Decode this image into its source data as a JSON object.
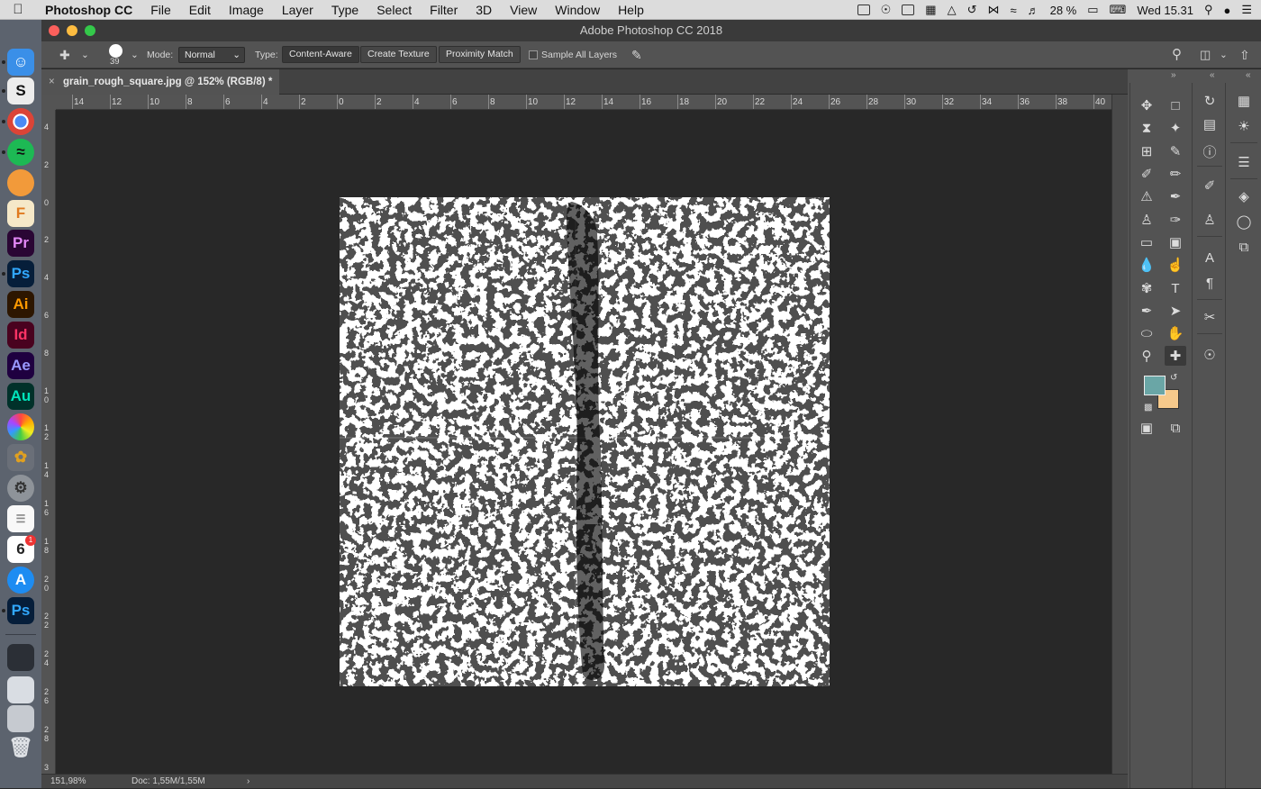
{
  "menubar": {
    "app_name": "Photoshop CC",
    "items": [
      "File",
      "Edit",
      "Image",
      "Layer",
      "Type",
      "Select",
      "Filter",
      "3D",
      "View",
      "Window",
      "Help"
    ],
    "battery": "28 %",
    "clock": "Wed 15.31"
  },
  "dock": {
    "apps": [
      {
        "name": "finder",
        "label": ""
      },
      {
        "name": "stack",
        "label": "S"
      },
      {
        "name": "chrome",
        "label": ""
      },
      {
        "name": "spotify",
        "label": ""
      },
      {
        "name": "other",
        "label": ""
      },
      {
        "name": "fusion",
        "label": "F"
      },
      {
        "name": "premiere",
        "label": "Pr"
      },
      {
        "name": "photoshop",
        "label": "Ps"
      },
      {
        "name": "illustrator",
        "label": "Ai"
      },
      {
        "name": "indesign",
        "label": "Id"
      },
      {
        "name": "aftereffects",
        "label": "Ae"
      },
      {
        "name": "audition",
        "label": "Au"
      },
      {
        "name": "photos",
        "label": ""
      },
      {
        "name": "fruit",
        "label": ""
      },
      {
        "name": "prefs",
        "label": ""
      },
      {
        "name": "reminders",
        "label": ""
      },
      {
        "name": "calendar",
        "label": "6"
      },
      {
        "name": "appstore",
        "label": ""
      },
      {
        "name": "photoshop2",
        "label": "Ps"
      }
    ],
    "calendar_badge": "1"
  },
  "window": {
    "title": "Adobe Photoshop CC 2018"
  },
  "options": {
    "brush_size": "39",
    "mode_label": "Mode:",
    "mode_value": "Normal",
    "type_label": "Type:",
    "type_buttons": [
      "Content-Aware",
      "Create Texture",
      "Proximity Match"
    ],
    "sample_all_layers": "Sample All Layers"
  },
  "document": {
    "tab_title": "grain_rough_square.jpg @ 152% (RGB/8) *",
    "close": "×"
  },
  "rulers": {
    "horizontal": [
      "14",
      "12",
      "10",
      "8",
      "6",
      "4",
      "2",
      "0",
      "2",
      "4",
      "6",
      "8",
      "10",
      "12",
      "14",
      "16",
      "18",
      "20",
      "22",
      "24",
      "26",
      "28",
      "30",
      "32",
      "34",
      "36",
      "38",
      "40"
    ],
    "vertical": [
      "4",
      "2",
      "0",
      "2",
      "4",
      "6",
      "8",
      "1\n0",
      "1\n2",
      "1\n4",
      "1\n6",
      "1\n8",
      "2\n0",
      "2\n2",
      "2\n4",
      "2\n6",
      "2\n8",
      "3"
    ]
  },
  "status": {
    "zoom": "151,98%",
    "doc": "Doc: 1,55M/1,55M"
  },
  "colors": {
    "foreground": "#6aa6a6",
    "background": "#f6c98b"
  }
}
